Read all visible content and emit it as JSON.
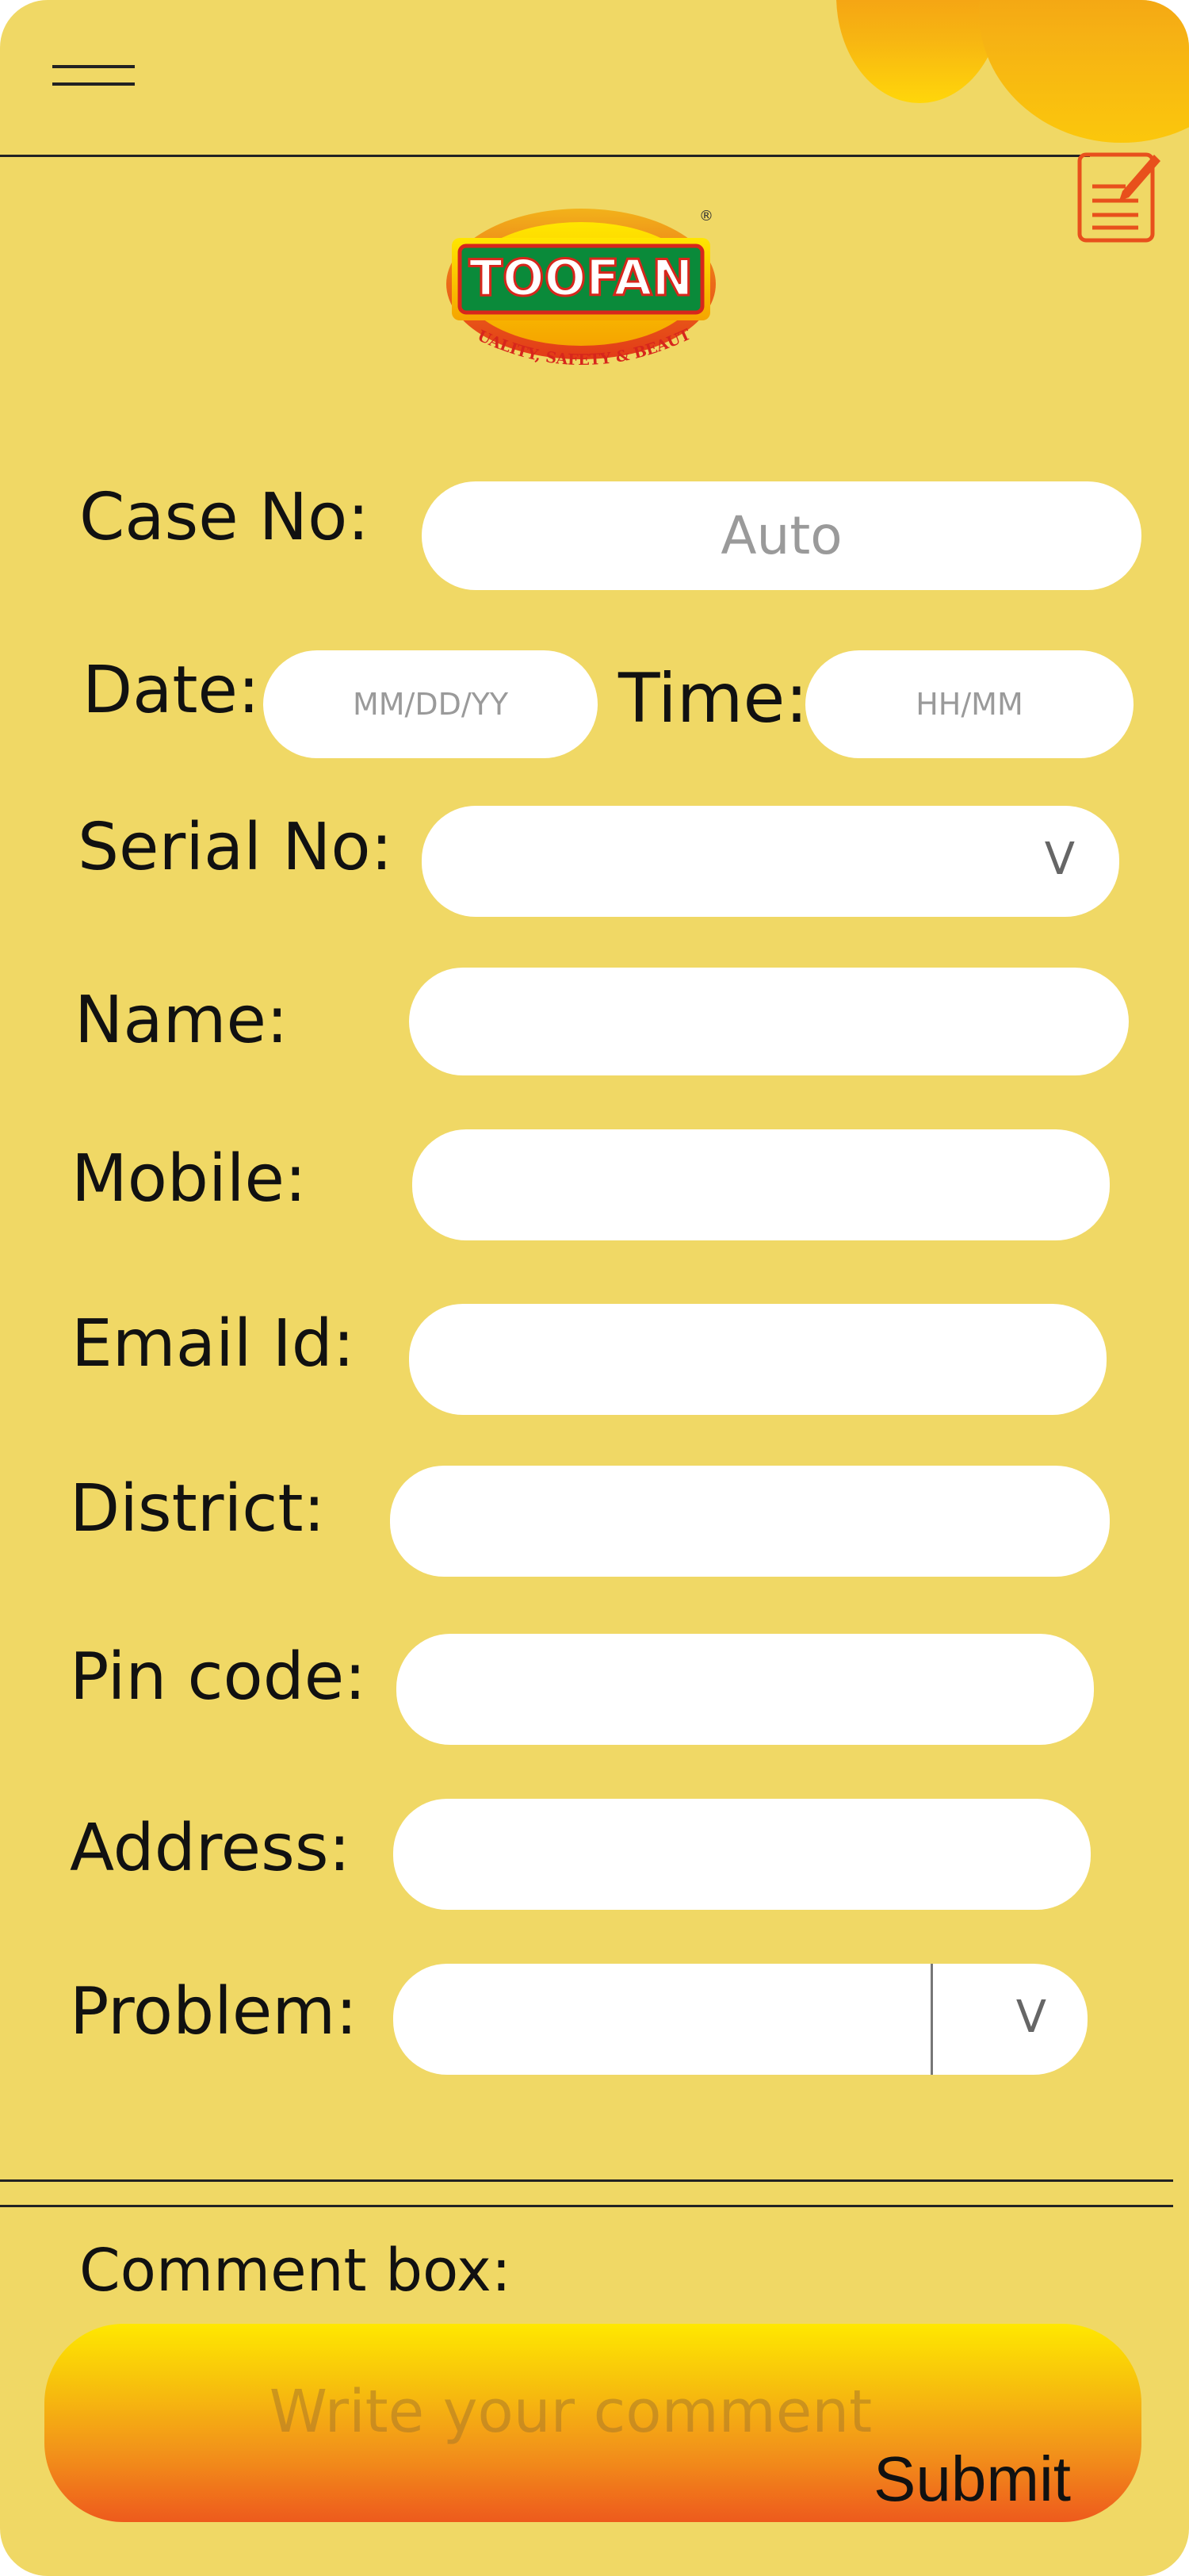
{
  "brand": {
    "logo_text": "TOOFAN",
    "tagline": "QUALITY, SAFETY & BEAUTY",
    "registered": "®"
  },
  "form": {
    "case_no": {
      "label": "Case No:",
      "placeholder": "Auto"
    },
    "date": {
      "label": "Date:",
      "placeholder": "MM/DD/YY"
    },
    "time": {
      "label": "Time:",
      "placeholder": "HH/MM"
    },
    "serial_no": {
      "label": "Serial No:",
      "value": ""
    },
    "name": {
      "label": "Name:",
      "value": ""
    },
    "mobile": {
      "label": "Mobile:",
      "value": ""
    },
    "email": {
      "label": "Email Id:",
      "value": ""
    },
    "district": {
      "label": "District:",
      "value": ""
    },
    "pincode": {
      "label": "Pin code:",
      "value": ""
    },
    "address": {
      "label": "Address:",
      "value": ""
    },
    "problem": {
      "label": "Problem:",
      "value": ""
    },
    "dropdown_glyph": "V"
  },
  "comment": {
    "label": "Comment box:",
    "placeholder": "Write your comment",
    "submit_label": "Submit"
  },
  "colors": {
    "background": "#f0d865",
    "field": "#ffffff",
    "accent_orange": "#ee5a1c",
    "accent_yellow": "#ffe800",
    "logo_green": "#0a8a3a",
    "logo_red": "#d7261c"
  },
  "icons": {
    "menu": "hamburger-menu-icon",
    "edit": "edit-note-icon"
  }
}
